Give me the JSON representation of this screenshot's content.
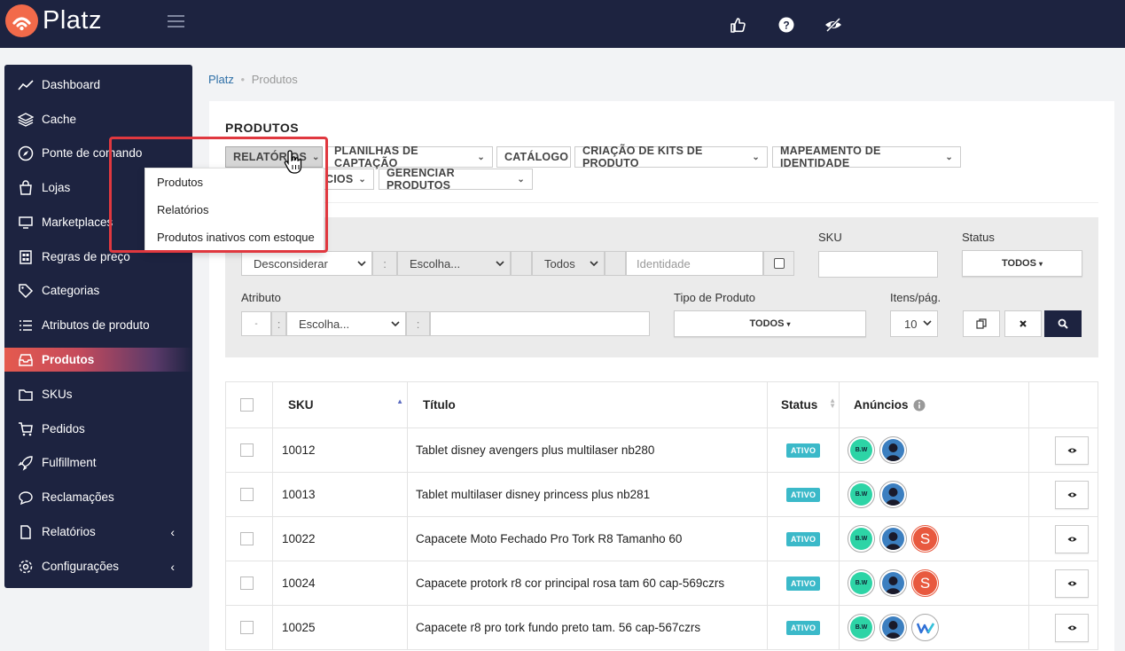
{
  "app": {
    "brand": "Platz"
  },
  "sidebar": {
    "items": [
      {
        "label": "Dashboard",
        "icon": "trend-line-icon"
      },
      {
        "label": "Cache",
        "icon": "layers-icon"
      },
      {
        "label": "Ponte de comando",
        "icon": "compass-icon"
      },
      {
        "label": "Lojas",
        "icon": "shopping-bag-icon"
      },
      {
        "label": "Marketplaces",
        "icon": "monitor-icon"
      },
      {
        "label": "Regras de preço",
        "icon": "calculator-icon"
      },
      {
        "label": "Categorias",
        "icon": "tag-icon"
      },
      {
        "label": "Atributos de produto",
        "icon": "list-icon"
      },
      {
        "label": "Produtos",
        "icon": "inbox-icon",
        "active": true
      },
      {
        "label": "SKUs",
        "icon": "folder-icon"
      },
      {
        "label": "Pedidos",
        "icon": "cart-icon"
      },
      {
        "label": "Fulfillment",
        "icon": "rocket-icon"
      },
      {
        "label": "Reclamações",
        "icon": "chat-icon"
      },
      {
        "label": "Relatórios",
        "icon": "document-icon",
        "chevron": "‹"
      },
      {
        "label": "Configurações",
        "icon": "gear-icon",
        "chevron": "‹"
      }
    ]
  },
  "breadcrumb": {
    "root": "Platz",
    "current": "Produtos"
  },
  "page": {
    "title": "PRODUTOS"
  },
  "toolbar": {
    "buttons": [
      {
        "label": "RELATÓRIOS"
      },
      {
        "label": "PLANILHAS DE CAPTAÇÃO"
      },
      {
        "label": "CATÁLOGO"
      },
      {
        "label": "CRIAÇÃO DE KITS DE PRODUTO"
      },
      {
        "label": "MAPEAMENTO DE IDENTIDADE"
      },
      {
        "label": "CIOS"
      },
      {
        "label": "GERENCIAR PRODUTOS"
      }
    ]
  },
  "dropdown": {
    "items": [
      "Produtos",
      "Relatórios",
      "Produtos inativos com estoque"
    ]
  },
  "filters": {
    "identity_mode": "Desconsiderar",
    "identity_sep": ":",
    "identity_choose": "Escolha...",
    "todos_select": "Todos",
    "identity_placeholder": "Identidade",
    "sku_label": "SKU",
    "status_label": "Status",
    "status_value": "TODOS",
    "attribute_label": "Atributo",
    "attribute_op": "-",
    "attribute_sep": ":",
    "attribute_choose": "Escolha...",
    "attribute_sep2": ":",
    "product_type_label": "Tipo de Produto",
    "product_type_value": "TODOS",
    "per_page_label": "Itens/pág.",
    "per_page_value": "10"
  },
  "table": {
    "headers": {
      "sku": "SKU",
      "title": "Título",
      "status": "Status",
      "ads": "Anúncios"
    },
    "rows": [
      {
        "sku": "10012",
        "title": "Tablet disney avengers plus multilaser nb280",
        "status": "ATIVO",
        "marketplaces": [
          "bw",
          "avatar"
        ]
      },
      {
        "sku": "10013",
        "title": "Tablet multilaser disney princess plus nb281",
        "status": "ATIVO",
        "marketplaces": [
          "bw",
          "avatar"
        ]
      },
      {
        "sku": "10022",
        "title": "Capacete Moto Fechado Pro Tork R8 Tamanho 60",
        "status": "ATIVO",
        "marketplaces": [
          "bw",
          "avatar",
          "s"
        ]
      },
      {
        "sku": "10024",
        "title": "Capacete protork r8 cor principal rosa tam 60 cap-569czrs",
        "status": "ATIVO",
        "marketplaces": [
          "bw",
          "avatar",
          "s"
        ]
      },
      {
        "sku": "10025",
        "title": "Capacete r8 pro tork fundo preto tam. 56 cap-567czrs",
        "status": "ATIVO",
        "marketplaces": [
          "bw",
          "avatar",
          "w"
        ]
      }
    ]
  },
  "marketplace_badges": {
    "bw": "B.W",
    "s": "S"
  },
  "colors": {
    "navy": "#1d2340",
    "accent": "#f26a4a",
    "badge": "#3bb9c9",
    "highlight": "#e0383f"
  }
}
